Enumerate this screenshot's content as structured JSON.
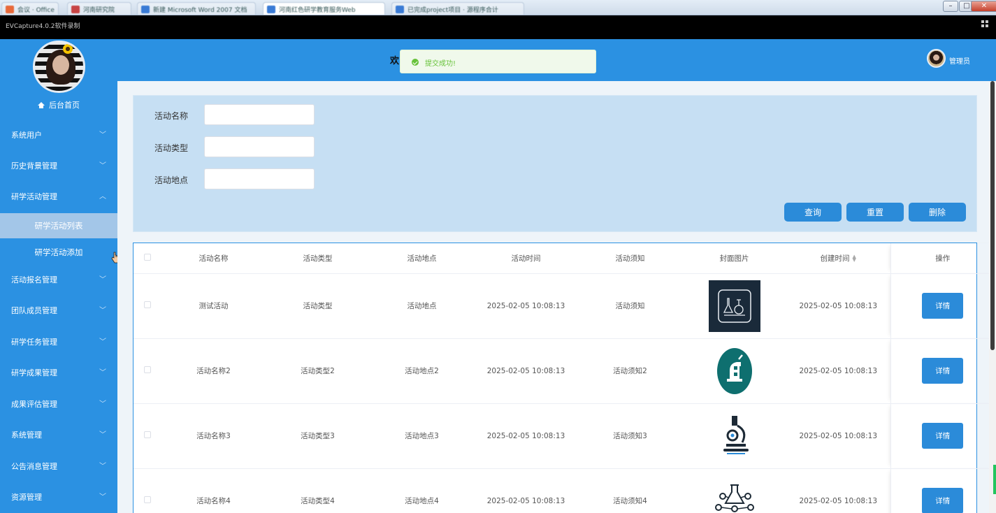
{
  "browser": {
    "tabs": [
      "会议 · Office",
      "河南研究院",
      "新建 Microsoft Word 2007 文档",
      "河南红色研学教育服务Web",
      "已完成project项目 · 源程序合计"
    ],
    "tab_colors": [
      "#e8693a",
      "#c74444",
      "#3a7bd5",
      "#3a7bd5",
      "#3a7bd5"
    ]
  },
  "recorder": {
    "title": "EVCapture4.0.2软件录制"
  },
  "sidebar": {
    "home_label": "后台首页",
    "items": [
      {
        "label": "系统用户",
        "icon": "chevron-down-icon"
      },
      {
        "label": "历史背景管理",
        "icon": "chevron-down-icon"
      },
      {
        "label": "研学活动管理",
        "icon": "chevron-up-icon"
      },
      {
        "label": "活动报名管理",
        "icon": "chevron-down-icon"
      },
      {
        "label": "团队成员管理",
        "icon": "chevron-down-icon"
      },
      {
        "label": "研学任务管理",
        "icon": "chevron-down-icon"
      },
      {
        "label": "研学成果管理",
        "icon": "chevron-down-icon"
      },
      {
        "label": "成果评估管理",
        "icon": "chevron-down-icon"
      },
      {
        "label": "系统管理",
        "icon": "chevron-down-icon"
      },
      {
        "label": "公告消息管理",
        "icon": "chevron-down-icon"
      },
      {
        "label": "资源管理",
        "icon": "chevron-down-icon"
      }
    ],
    "submenu": [
      {
        "label": "研学活动列表",
        "active": true
      },
      {
        "label": "研学活动添加",
        "active": false
      }
    ]
  },
  "header": {
    "welcome_partial": "欢",
    "toast_message": "提交成功!",
    "admin_label": "管理员"
  },
  "search": {
    "fields": [
      {
        "label": "活动名称",
        "value": ""
      },
      {
        "label": "活动类型",
        "value": ""
      },
      {
        "label": "活动地点",
        "value": ""
      }
    ],
    "buttons": {
      "query": "查询",
      "reset": "重置",
      "delete": "删除"
    }
  },
  "table": {
    "columns": [
      "活动名称",
      "活动类型",
      "活动地点",
      "活动时间",
      "活动须知",
      "封面图片",
      "创建时间",
      "操作"
    ],
    "rows": [
      {
        "name": "测试活动",
        "type": "活动类型",
        "place": "活动地点",
        "time": "2025-02-05 10:08:13",
        "notice": "活动须知",
        "cover": "lab-tools-icon",
        "created": "2025-02-05 10:08:13",
        "action": "详情"
      },
      {
        "name": "活动名称2",
        "type": "活动类型2",
        "place": "活动地点2",
        "time": "2025-02-05 10:08:13",
        "notice": "活动须知2",
        "cover": "microscope-badge-icon",
        "created": "2025-02-05 10:08:13",
        "action": "详情"
      },
      {
        "name": "活动名称3",
        "type": "活动类型3",
        "place": "活动地点3",
        "time": "2025-02-05 10:08:13",
        "notice": "活动须知3",
        "cover": "microscope-icon",
        "created": "2025-02-05 10:08:13",
        "action": "详情"
      },
      {
        "name": "活动名称4",
        "type": "活动类型4",
        "place": "活动地点4",
        "time": "2025-02-05 10:08:13",
        "notice": "活动须知4",
        "cover": "molecule-flask-icon",
        "created": "2025-02-05 10:08:13",
        "action": "详情"
      }
    ]
  },
  "colors": {
    "primary": "#2b91e2",
    "button": "#2b8bd9",
    "success": "#67c23a",
    "panel": "#c6dff3"
  }
}
